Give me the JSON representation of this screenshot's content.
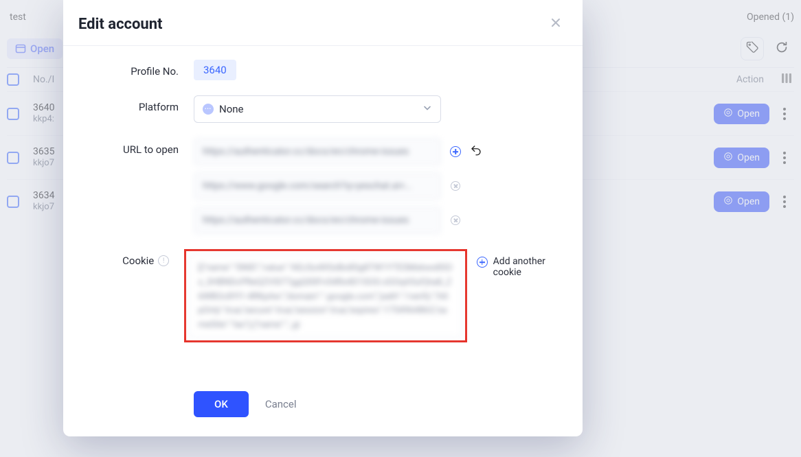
{
  "header": {
    "group_label": "test",
    "opened_text": "Opened (1)"
  },
  "toolbar": {
    "open_label": "Open"
  },
  "table": {
    "head_no": "No./I",
    "head_action": "Action",
    "rows": [
      {
        "no": "3640",
        "name": "kkp4:",
        "action": "Open"
      },
      {
        "no": "3635",
        "name": "kkjo7",
        "action": "Open"
      },
      {
        "no": "3634",
        "name": "kkjo7",
        "action": "Open"
      }
    ]
  },
  "modal": {
    "title": "Edit account",
    "labels": {
      "profile_no": "Profile No.",
      "platform": "Platform",
      "url_to_open": "URL to open",
      "cookie": "Cookie"
    },
    "profile_no": "3640",
    "platform_selected": "None",
    "urls": [
      "https://authenticator.cc/docs/en/chrome-issues",
      "https://www.google.com/search?q=yeschat.ai+…",
      "https://authenticator.cc/docs/en/chrome-issues"
    ],
    "cookie_value": "[{\"name\":\"SNID\",\"value\":\"AEcSo4XSxBo8Sg8TW1YTESMxkwx8SOz_3HBNDcPReQZVSl77ggQ00Fn54Rx4D1SOG-zGOqA5uFjha8_Z6WBOc8Yl1-4RKpAw\",\"domain\":\".google.com\",\"path\":\"/verify\",\"httpOnly\":true,\"secure\":true,\"session\":true,\"expires\":1754964863,\"sameSite\":\"lax\"},{\"name\":\"_gi",
    "add_cookie": "Add another cookie",
    "ok": "OK",
    "cancel": "Cancel"
  }
}
